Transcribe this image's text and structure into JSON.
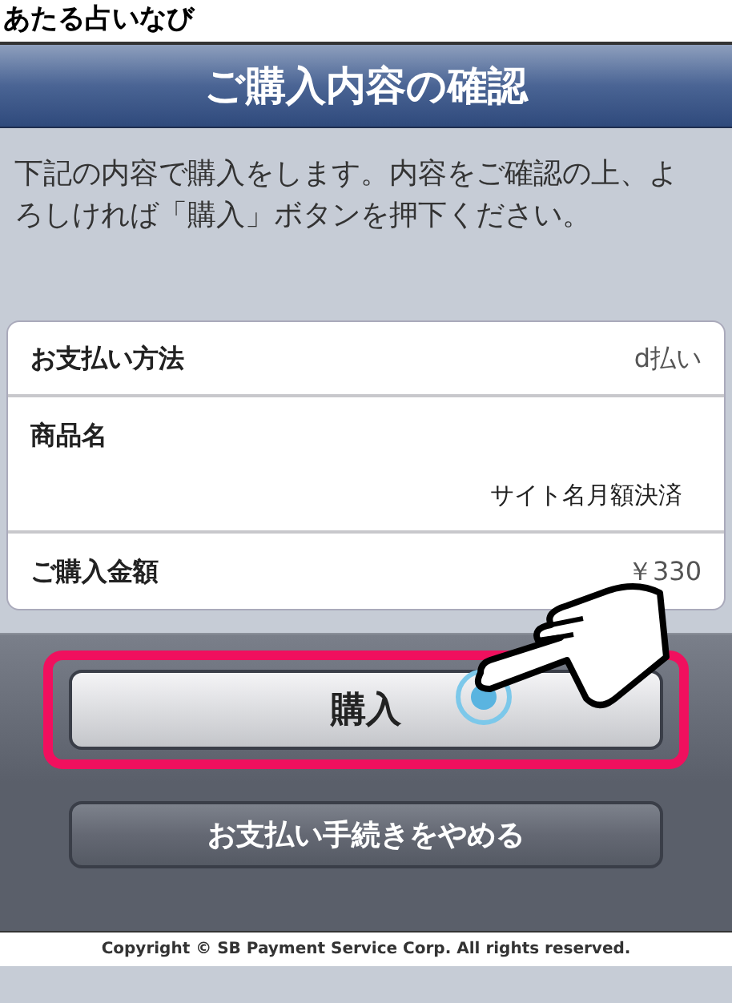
{
  "header": {
    "site_name": "あたる占いなび"
  },
  "title": "ご購入内容の確認",
  "instructions": "下記の内容で購入をします。内容をご確認の上、よろしければ「購入」ボタンを押下ください。",
  "details": [
    {
      "label": "お支払い方法",
      "value": "d払い",
      "kind": "inline"
    },
    {
      "label": "商品名",
      "value": "サイト名月額決済",
      "kind": "stacked"
    },
    {
      "label": "ご購入金額",
      "value": "￥330",
      "kind": "inline"
    }
  ],
  "buttons": [
    {
      "label": "購入",
      "kind": "primary",
      "highlighted": true
    },
    {
      "label": "お支払い手続きをやめる",
      "kind": "secondary",
      "highlighted": false
    }
  ],
  "footer": "Copyright © SB Payment Service Corp. All rights reserved."
}
